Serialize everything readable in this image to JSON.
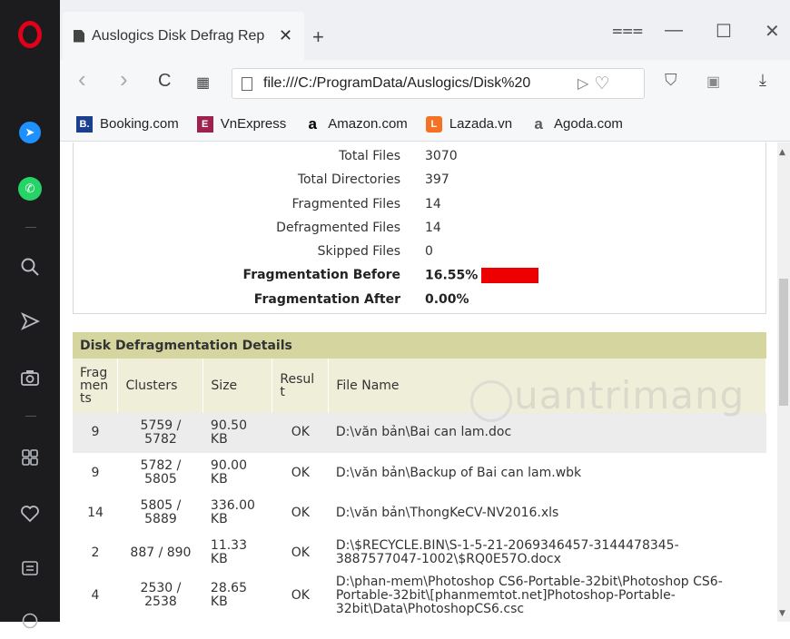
{
  "sidebar": {
    "icons": [
      "opera-logo",
      "messenger-icon",
      "whatsapp-icon",
      "search-icon",
      "send-icon",
      "camera-icon",
      "speed-dial-icon",
      "heart-icon",
      "news-icon",
      "clock-icon"
    ]
  },
  "tab": {
    "title": "Auslogics Disk Defrag Rep",
    "close": "✕",
    "new_tab": "+"
  },
  "window": {
    "menu": "⩶",
    "minimize": "—",
    "maximize": "☐",
    "close": "✕"
  },
  "address": {
    "back": "‹",
    "forward": "›",
    "reload": "C",
    "tabs_glyph": "▦",
    "url": "file:///C:/ProgramData/Auslogics/Disk%20",
    "send": "▷",
    "heart": "♡",
    "vpn": "⛉",
    "snapshot": "▣",
    "download": "⤓"
  },
  "bookmarks": [
    {
      "label": "Booking.com",
      "icon": "B.",
      "color": "#1a3f8f"
    },
    {
      "label": "VnExpress",
      "icon": "E",
      "color": "#9f224e"
    },
    {
      "label": "Amazon.com",
      "icon": "a",
      "color": "#000000"
    },
    {
      "label": "Lazada.vn",
      "icon": "L",
      "color": "#f57224"
    },
    {
      "label": "Agoda.com",
      "icon": "a",
      "color": "#5a5a5a"
    }
  ],
  "summary": {
    "rows": [
      {
        "label": "Total Files",
        "value": "3070",
        "bold": false
      },
      {
        "label": "Total Directories",
        "value": "397",
        "bold": false
      },
      {
        "label": "Fragmented Files",
        "value": "14",
        "bold": false
      },
      {
        "label": "Defragmented Files",
        "value": "14",
        "bold": false
      },
      {
        "label": "Skipped Files",
        "value": "0",
        "bold": false
      },
      {
        "label": "Fragmentation Before",
        "value": "16.55%",
        "bold": true
      },
      {
        "label": "Fragmentation After",
        "value": "0.00%",
        "bold": true
      }
    ],
    "fragmentation_bar_color": "#ee0000"
  },
  "details": {
    "title": "Disk Defragmentation Details",
    "headers": {
      "fragments": "Frag\nmen\nts",
      "clusters": "Clusters",
      "size": "Size",
      "result": "Resul\nt",
      "filename": "File Name"
    },
    "rows": [
      {
        "fragments": "9",
        "clusters": "5759 /\n5782",
        "size": "90.50\nKB",
        "result": "OK",
        "filename": "D:\\văn bản\\Bai can lam.doc"
      },
      {
        "fragments": "9",
        "clusters": "5782 /\n5805",
        "size": "90.00\nKB",
        "result": "OK",
        "filename": "D:\\văn bản\\Backup of Bai can lam.wbk"
      },
      {
        "fragments": "14",
        "clusters": "5805 /\n5889",
        "size": "336.00\nKB",
        "result": "OK",
        "filename": "D:\\văn bản\\ThongKeCV-NV2016.xls"
      },
      {
        "fragments": "2",
        "clusters": "887 / 890",
        "size": "11.33\nKB",
        "result": "OK",
        "filename": "D:\\$RECYCLE.BIN\\S-1-5-21-2069346457-3144478345-3887577047-1002\\$RQ0E57O.docx"
      },
      {
        "fragments": "4",
        "clusters": "2530 /\n2538",
        "size": "28.65\nKB",
        "result": "OK",
        "filename": "D:\\phan-mem\\Photoshop CS6-Portable-32bit\\Photoshop CS6-Portable-32bit\\[phanmemtot.net]Photoshop-Portable-32bit\\Data\\PhotoshopCS6.csc"
      }
    ]
  },
  "watermark": "uantrimang"
}
